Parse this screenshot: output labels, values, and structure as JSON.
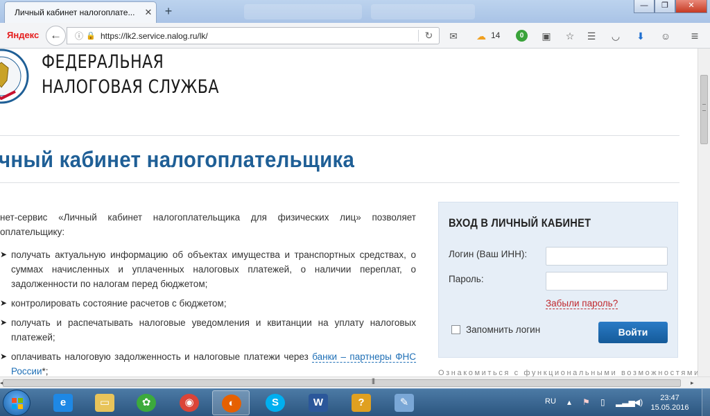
{
  "browser": {
    "tab_title": "Личный кабинет налогоплате...",
    "tab_close": "✕",
    "new_tab": "+",
    "brand": "Яндекс",
    "url": "https://lk2.service.nalog.ru/lk/",
    "weather_count": "14",
    "green_badge": "0",
    "window_buttons": {
      "minimize": "—",
      "maximize": "❐",
      "close": "✕"
    }
  },
  "page": {
    "org_line1": "ФЕДЕРАЛЬНАЯ",
    "org_line2": "НАЛОГОВАЯ СЛУЖБА",
    "title": "чный кабинет налогоплательщика",
    "intro": "нет-сервис «Личный кабинет налогоплательщика для физических лиц» позволяет оплательщику:",
    "features": [
      "получать актуальную информацию об объектах имущества и транспортных средствах, о суммах начисленных и уплаченных налоговых платежей, о наличии переплат, о задолженности по налогам перед бюджетом;",
      "контролировать состояние расчетов с бюджетом;",
      "получать и распечатывать налоговые уведомления и квитанции на уплату налоговых платежей;",
      "оплачивать налоговую задолженность и налоговые платежи через "
    ],
    "feature4_link": "банки – партнеры ФНС России",
    "feature4_suffix": "*;",
    "bottom_note": "Ознакомиться с функциональными возможностями сервиса"
  },
  "login": {
    "title": "ВХОД В ЛИЧНЫЙ КАБИНЕТ",
    "login_label": "Логин (Ваш ИНН):",
    "password_label": "Пароль:",
    "forgot": "Забыли пароль?",
    "remember": "Запомнить логин",
    "submit": "Войти"
  },
  "taskbar": {
    "lang": "RU",
    "time": "23:47",
    "date": "15.05.2016",
    "apps": [
      "internet-explorer",
      "file-explorer",
      "icq",
      "chrome",
      "firefox",
      "skype",
      "word",
      "excel",
      "paint"
    ]
  },
  "colors": {
    "title_blue": "#1f5f96",
    "link_blue": "#1e6fb6",
    "forgot_red": "#c0282d",
    "button_blue": "#1a6aae",
    "panel_bg": "#e6eef7"
  }
}
